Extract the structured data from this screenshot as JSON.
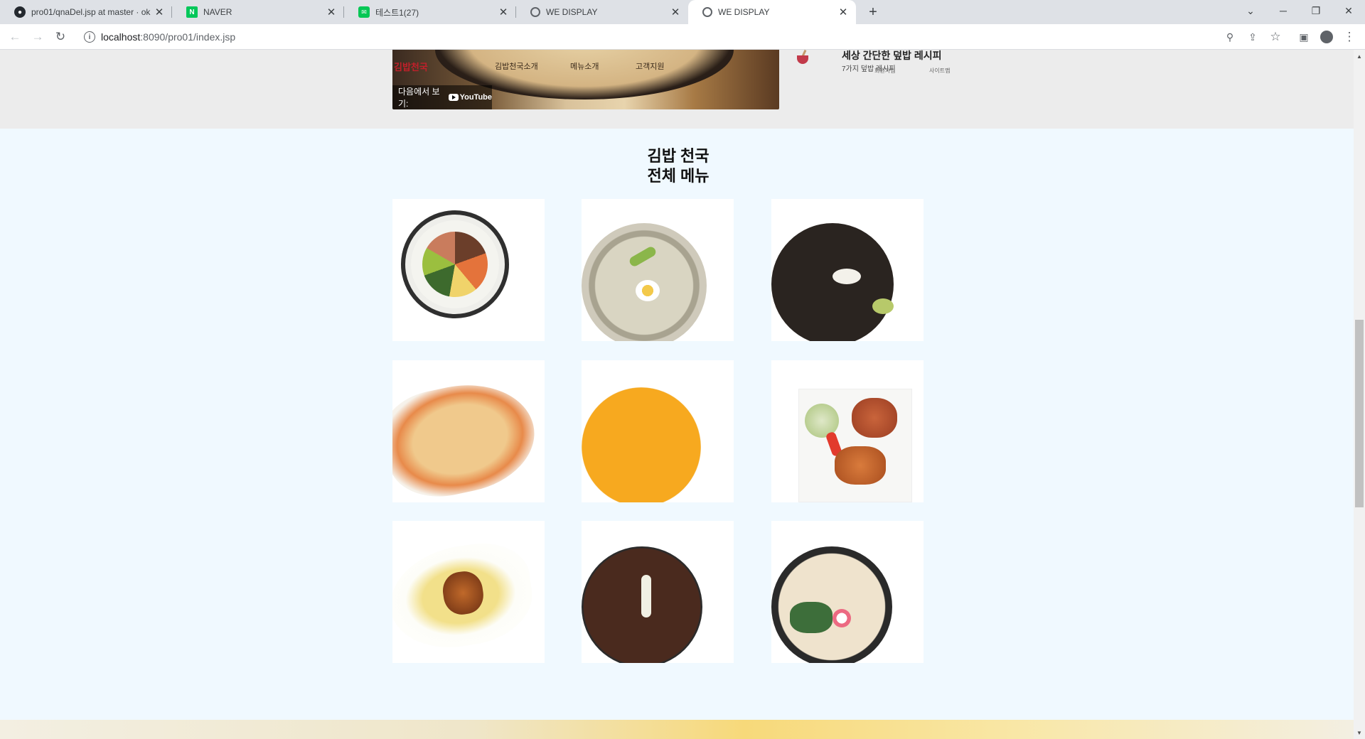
{
  "browser": {
    "tabs": [
      {
        "title": "pro01/qnaDel.jsp at master · ok",
        "favicon": "github-icon"
      },
      {
        "title": "NAVER",
        "favicon": "naver-icon"
      },
      {
        "title": "테스트1(27)",
        "favicon": "line-icon"
      },
      {
        "title": "WE DISPLAY",
        "favicon": "globe-icon"
      },
      {
        "title": "WE DISPLAY",
        "favicon": "globe-icon",
        "active": true
      }
    ],
    "url_host": "localhost",
    "url_path": ":8090/pro01/index.jsp"
  },
  "video": {
    "watch_label": "다음에서 보기:",
    "yt_label": "YouTube",
    "nav_items": [
      "김밥천국소개",
      "메뉴소개",
      "고객지원"
    ],
    "brand": "김밥천국"
  },
  "recipe": {
    "title": "세상 간단한 덮밥 레시피",
    "subtitle": "7가지 덮밥 레시피",
    "links": [
      "회원가입",
      "사이트맵"
    ]
  },
  "menu": {
    "heading_line1": "김밥 천국",
    "heading_line2": "전체 메뉴",
    "items": [
      "kimbap",
      "naengmyeon",
      "jjajangmyeon",
      "pizza-gratin",
      "pumpkin-porridge",
      "pork-cutlet",
      "omurice",
      "bulgogi-stew",
      "udon"
    ]
  },
  "colors": {
    "page_bg": "#f0f9ff",
    "top_band": "#ececec",
    "tabstrip": "#dee1e6"
  }
}
